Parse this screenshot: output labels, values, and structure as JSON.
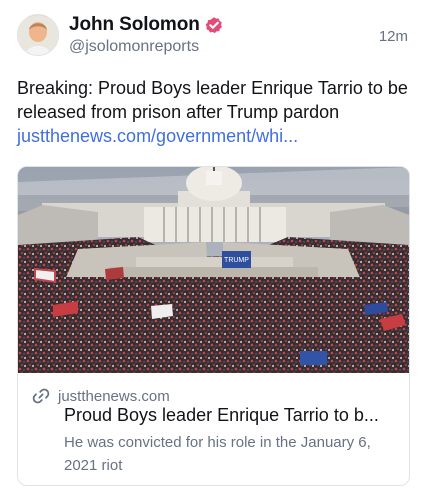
{
  "author": {
    "name": "John Solomon",
    "handle": "@jsolomonreports",
    "time": "12m"
  },
  "post": {
    "text": "Breaking: Proud Boys leader Enrique Tarrio to be released from prison after Trump pardon",
    "link_text": "justthenews.com/government/whi..."
  },
  "card": {
    "domain": "justthenews.com",
    "title": "Proud Boys leader Enrique Tarrio to b...",
    "description": "He was convicted for his role in the January 6, 2021 riot",
    "image_sign_text": "TRUMP"
  },
  "colors": {
    "verified_badge": "#e54b78",
    "link": "#3f6fe0",
    "secondary_text": "#687282"
  },
  "icons": {
    "verified": "verified-badge-icon",
    "link": "link-icon"
  }
}
